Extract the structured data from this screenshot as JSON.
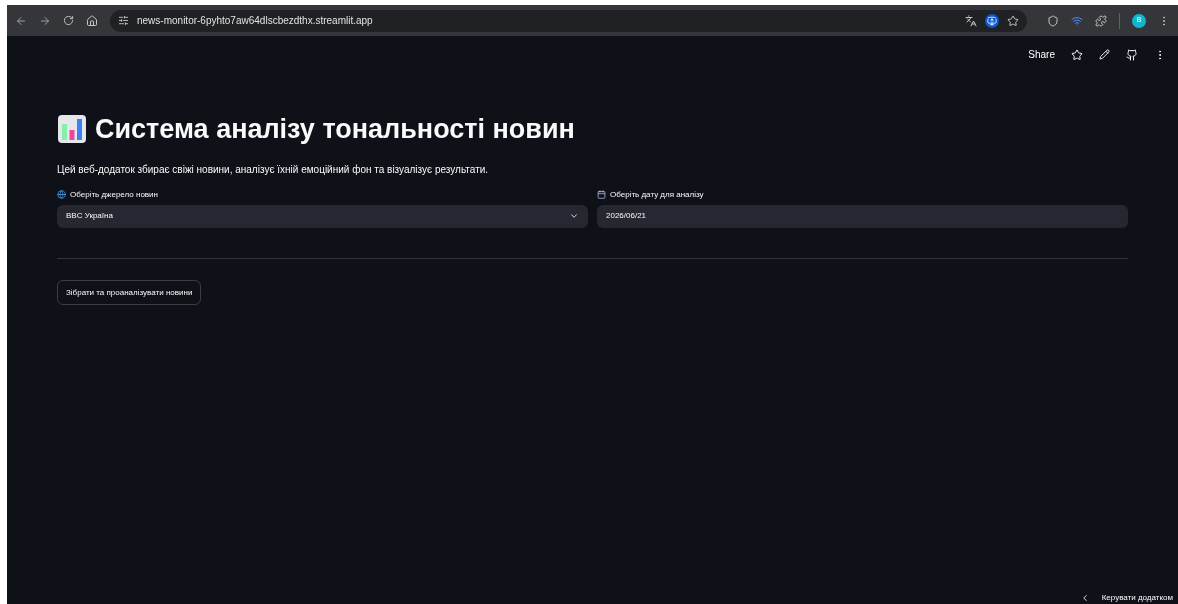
{
  "browser": {
    "url": "news-monitor-6pyhto7aw64dlscbezdthx.streamlit.app",
    "profile_initial": "B"
  },
  "header": {
    "share": "Share"
  },
  "title": "Система аналізу тональності новин",
  "description": "Цей веб-додаток збирає свіжі новини, аналізує їхній емоційний фон та візуалізує результати.",
  "fields": [
    {
      "kind": "select",
      "label": "Оберіть джерело новин",
      "value": "BBC Україна"
    },
    {
      "kind": "date",
      "label": "Оберіть дату для аналізу",
      "value": "2026/06/21"
    }
  ],
  "button": "Зібрати та проаналізувати новини",
  "manage_app": "Керувати додатком"
}
